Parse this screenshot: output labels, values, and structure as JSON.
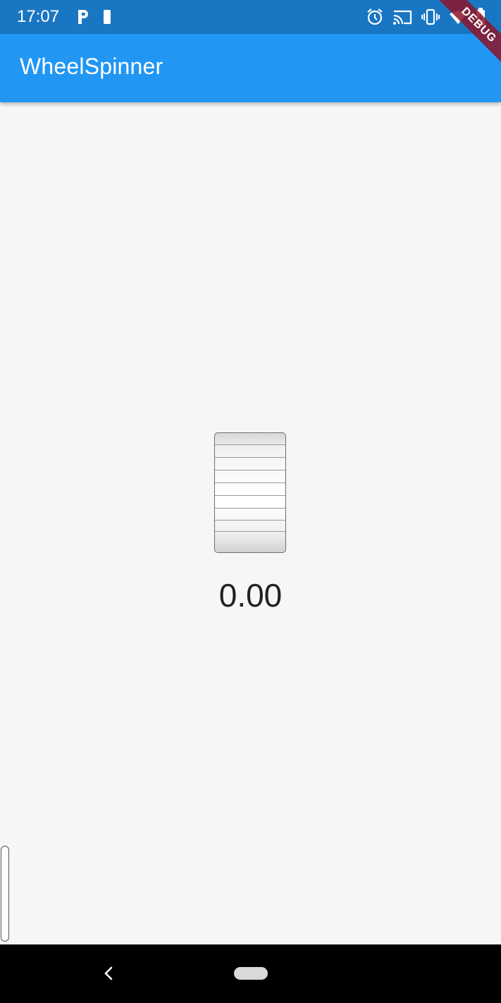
{
  "status_bar": {
    "time": "17:07",
    "left_icons": [
      "parking-icon",
      "battery-saver-icon"
    ],
    "right_icons": [
      "alarm-icon",
      "cast-icon",
      "vibrate-icon",
      "wifi-icon",
      "battery-charging-icon"
    ]
  },
  "app_bar": {
    "title": "WheelSpinner",
    "color": "#2196f3",
    "debug_banner": "DEBUG"
  },
  "spinner": {
    "value": "0.00"
  },
  "nav_bar": {
    "buttons": [
      "back-icon",
      "home-icon"
    ]
  }
}
